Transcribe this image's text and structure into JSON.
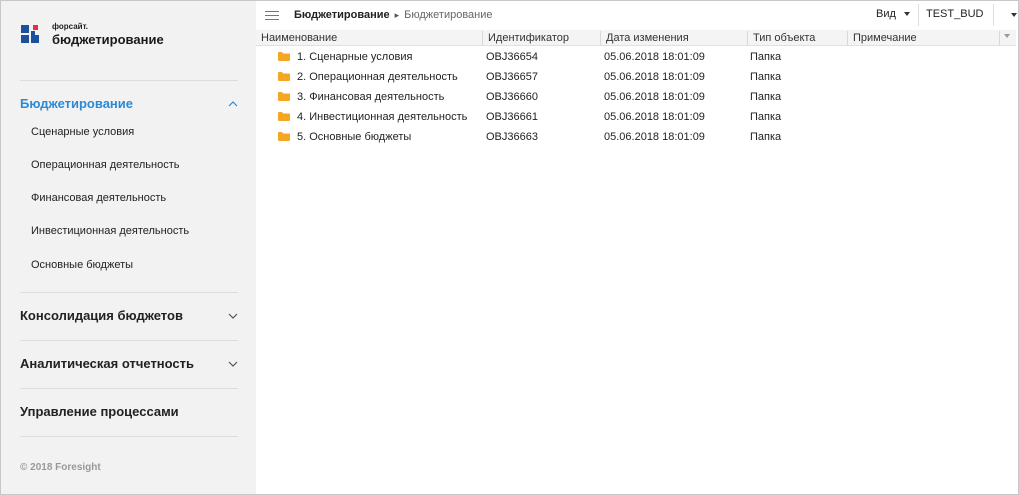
{
  "sidebar": {
    "logo_small": "форсайт.",
    "logo_big": "бюджетирование",
    "sections": [
      {
        "title": "Бюджетирование",
        "expanded": true,
        "items": [
          "Сценарные условия",
          "Операционная деятельность",
          "Финансовая деятельность",
          "Инвестиционная деятельность",
          "Основные бюджеты"
        ]
      },
      {
        "title": "Консолидация бюджетов",
        "expanded": false
      },
      {
        "title": "Аналитическая отчетность",
        "expanded": false
      },
      {
        "title": "Управление процессами"
      }
    ],
    "copyright": "© 2018 Foresight"
  },
  "topbar": {
    "breadcrumb_root": "Бюджетирование",
    "breadcrumb_current": "Бюджетирование",
    "view_label": "Вид",
    "user": "TEST_BUD"
  },
  "table": {
    "columns": [
      "Наименование",
      "Идентификатор",
      "Дата изменения",
      "Тип объекта",
      "Примечание"
    ],
    "rows": [
      {
        "name": "1. Сценарные условия",
        "id": "OBJ36654",
        "date": "05.06.2018 18:01:09",
        "type": "Папка",
        "note": ""
      },
      {
        "name": "2. Операционная деятельность",
        "id": "OBJ36657",
        "date": "05.06.2018 18:01:09",
        "type": "Папка",
        "note": ""
      },
      {
        "name": "3. Финансовая деятельность",
        "id": "OBJ36660",
        "date": "05.06.2018 18:01:09",
        "type": "Папка",
        "note": ""
      },
      {
        "name": "4. Инвестиционная деятельность",
        "id": "OBJ36661",
        "date": "05.06.2018 18:01:09",
        "type": "Папка",
        "note": ""
      },
      {
        "name": "5. Основные бюджеты",
        "id": "OBJ36663",
        "date": "05.06.2018 18:01:09",
        "type": "Папка",
        "note": ""
      }
    ]
  },
  "icons": {
    "logo": "foresight-logo-icon",
    "menu": "hamburger-menu-icon",
    "folder": "folder-icon",
    "chevron_up": "chevron-up-icon",
    "chevron_down": "chevron-down-icon"
  },
  "colors": {
    "accent": "#2b8ad6",
    "logo_blue": "#1e4f9c",
    "logo_red": "#e3323c",
    "folder": "#f5a623",
    "sidebar_bg": "#f2f2f2"
  }
}
